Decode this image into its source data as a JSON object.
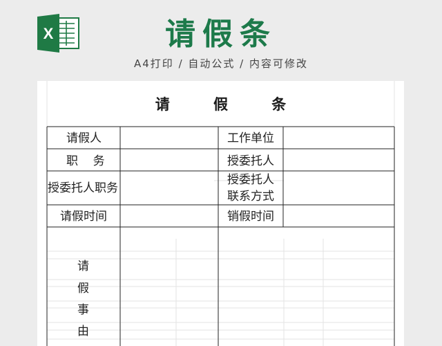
{
  "banner": {
    "logo_letter": "X",
    "title": "请假条",
    "subtitle": "A4打印 / 自动公式 / 内容可修改"
  },
  "form": {
    "title": "请  假  条",
    "labels": {
      "applicant": "请假人",
      "work_unit": "工作单位",
      "position": "职    务",
      "delegate": "授委托人",
      "delegate_position": "授委托人职务",
      "delegate_contact_line1": "授委托人",
      "delegate_contact_line2": "联系方式",
      "leave_time": "请假时间",
      "cancel_time": "销假时间",
      "reason_chars": [
        "请",
        "假",
        "事",
        "由"
      ]
    },
    "values": {
      "applicant": "",
      "work_unit": "",
      "position": "",
      "delegate": "",
      "delegate_position": "",
      "delegate_contact": "",
      "leave_time": "",
      "cancel_time": ""
    }
  },
  "colors": {
    "brand_green": "#1d7a4a",
    "excel_green": "#1f7a45"
  }
}
